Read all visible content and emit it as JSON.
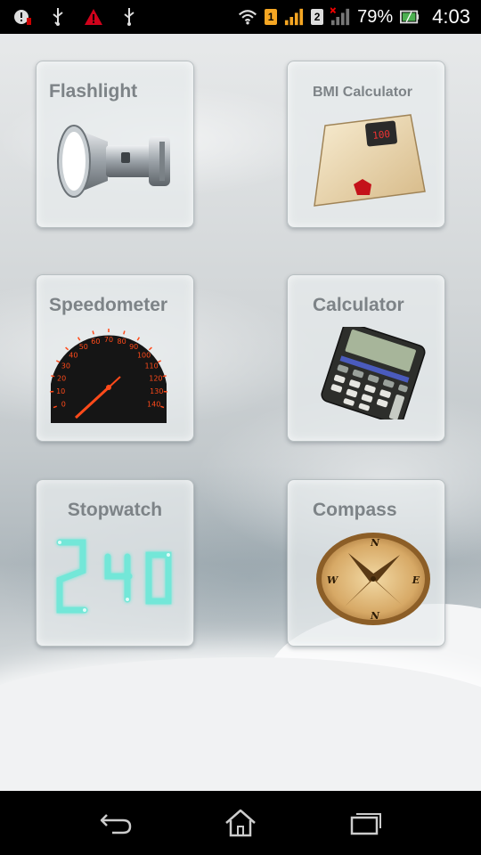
{
  "status_bar": {
    "battery_percent": "79%",
    "time": "4:03",
    "sim1_label": "1",
    "sim2_label": "2",
    "left_icons": [
      "debug-icon",
      "usb-icon",
      "warning-icon",
      "usb-icon"
    ],
    "right_icons": [
      "wifi-icon",
      "sim1-badge",
      "signal-icon",
      "sim2-badge",
      "signal-icon",
      "battery-icon"
    ],
    "colors": {
      "sim1": "#f5a623",
      "warning": "#d0021b",
      "battery_fill": "#4caf50"
    }
  },
  "tiles": [
    {
      "label": "Flashlight",
      "icon": "flashlight-icon"
    },
    {
      "label": "BMI Calculator",
      "icon": "bathroom-scale-icon",
      "scale_display": "100"
    },
    {
      "label": "Speedometer",
      "icon": "speedometer-icon",
      "gauge_ticks": [
        "0",
        "10",
        "20",
        "30",
        "40",
        "50",
        "60",
        "70",
        "80",
        "90",
        "100",
        "110",
        "120",
        "130",
        "140"
      ]
    },
    {
      "label": "Calculator",
      "icon": "calculator-icon"
    },
    {
      "label": "Stopwatch",
      "icon": "stopwatch-digits-icon",
      "digits": [
        "2",
        "4",
        "0"
      ]
    },
    {
      "label": "Compass",
      "icon": "compass-icon",
      "directions": [
        "N",
        "E",
        "N",
        "W"
      ]
    }
  ],
  "nav_bar": {
    "buttons": [
      "back-icon",
      "home-icon",
      "recent-apps-icon"
    ]
  }
}
